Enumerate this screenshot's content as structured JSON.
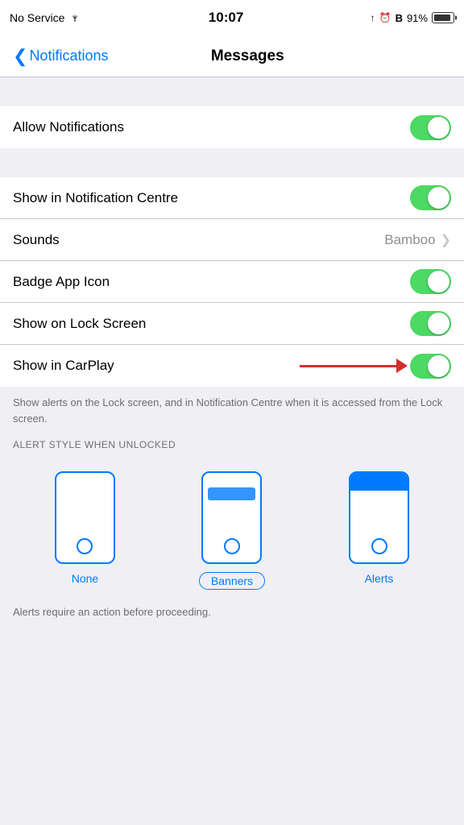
{
  "statusBar": {
    "carrier": "No Service",
    "time": "10:07",
    "battery": "91%"
  },
  "navBar": {
    "backLabel": "Notifications",
    "title": "Messages"
  },
  "rows": [
    {
      "id": "allow-notifications",
      "label": "Allow Notifications",
      "type": "toggle",
      "on": true
    },
    {
      "id": "show-notification-centre",
      "label": "Show in Notification Centre",
      "type": "toggle",
      "on": true
    },
    {
      "id": "sounds",
      "label": "Sounds",
      "type": "value",
      "value": "Bamboo"
    },
    {
      "id": "badge-app-icon",
      "label": "Badge App Icon",
      "type": "toggle",
      "on": true
    },
    {
      "id": "show-lock-screen",
      "label": "Show on Lock Screen",
      "type": "toggle",
      "on": true
    },
    {
      "id": "show-carplay",
      "label": "Show in CarPlay",
      "type": "toggle",
      "on": true,
      "hasArrow": true
    }
  ],
  "description": "Show alerts on the Lock screen, and in Notification Centre when it is accessed from the Lock screen.",
  "alertStyleHeader": "ALERT STYLE WHEN UNLOCKED",
  "alertStyles": [
    {
      "id": "none",
      "label": "None",
      "selected": false,
      "type": "none"
    },
    {
      "id": "banners",
      "label": "Banners",
      "selected": true,
      "type": "banners"
    },
    {
      "id": "alerts",
      "label": "Alerts",
      "selected": false,
      "type": "alerts"
    }
  ],
  "footerText": "Alerts require an action before proceeding."
}
